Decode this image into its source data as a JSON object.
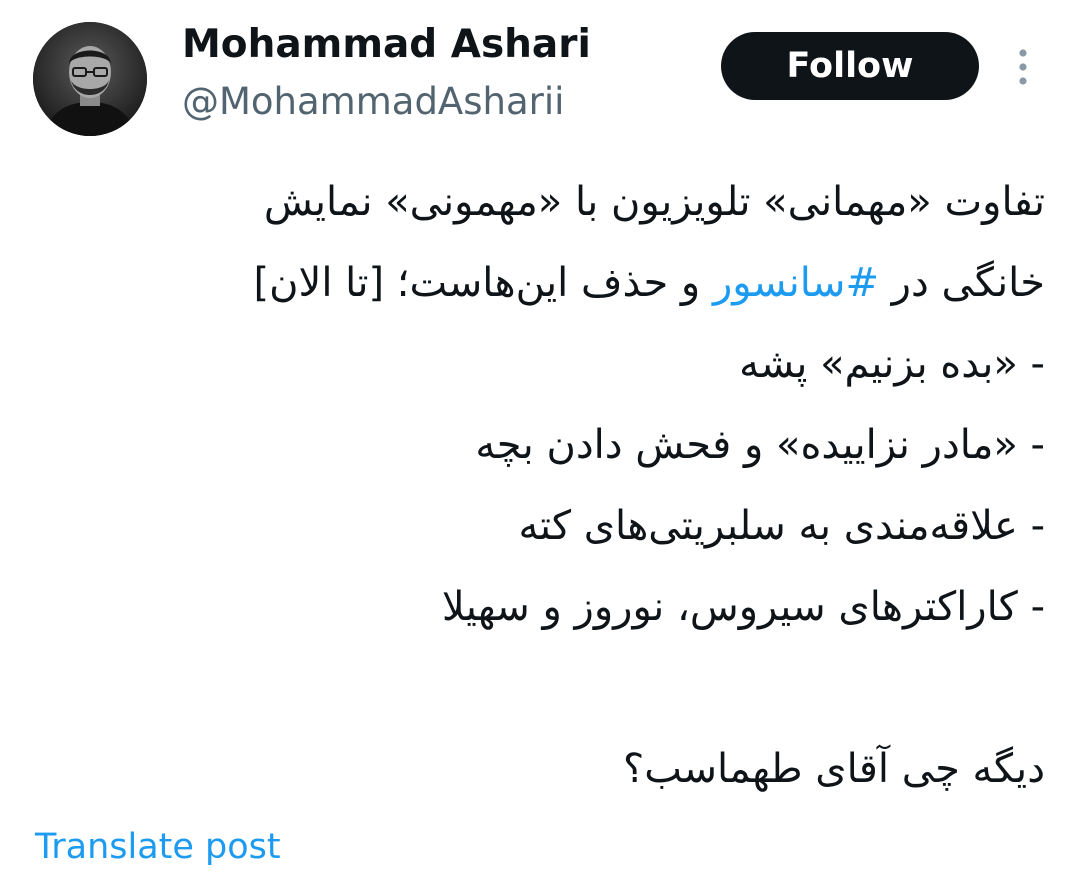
{
  "author": {
    "display_name": "Mohammad Ashari",
    "handle": "@MohammadAsharii"
  },
  "actions": {
    "follow_label": "Follow",
    "more_icon": "more-vertical-icon"
  },
  "post": {
    "line_1_and_2": "تفاوت «مهمانی» تلویزیون با «مهمونی» نمایش",
    "line_3_before": "خانگی در ",
    "hashtag": "#سانسور",
    "line_3_after": " و حذف این‌هاست؛ [تا الان]",
    "list_items": [
      "- «بده بزنیم» پشه",
      "- «مادر نزاییده» و فحش دادن بچه",
      "- علاقه‌مندی به سلبریتی‌های کته",
      "- کاراکترهای سیروس، نوروز و سهیلا"
    ],
    "closing": "دیگه چی آقای طهماسب؟"
  },
  "footer": {
    "translate_label": "Translate post"
  },
  "colors": {
    "text": "#0f1419",
    "secondary": "#536471",
    "link": "#1d9bf0",
    "button_bg": "#0f1419",
    "button_text": "#ffffff"
  }
}
